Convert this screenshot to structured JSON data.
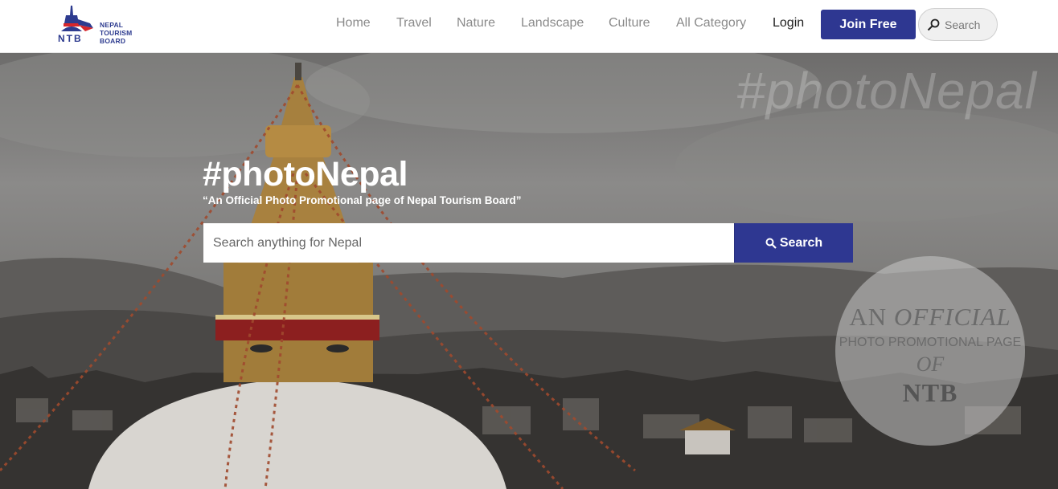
{
  "brand": {
    "logo_lines": [
      "NEPAL",
      "TOURISM",
      "BOARD"
    ],
    "logo_abbr": "NTB"
  },
  "nav": {
    "links": [
      "Home",
      "Travel",
      "Nature",
      "Landscape",
      "Culture",
      "All Category"
    ],
    "login": "Login",
    "join": "Join Free",
    "search_placeholder": "Search"
  },
  "hero": {
    "watermark": "#photoNepal",
    "title": "#photoNepal",
    "subtitle": "“An Official Photo Promotional page of Nepal Tourism Board”",
    "search_placeholder": "Search anything for Nepal",
    "search_button": "Search"
  },
  "badge": {
    "line1_a": "AN ",
    "line1_b": "OFFICIAL",
    "line2": "PHOTO PROMOTIONAL PAGE",
    "line3": "OF",
    "line4": "NTB"
  },
  "colors": {
    "brand_blue": "#2e3791",
    "nav_text": "#8a8a8a"
  }
}
